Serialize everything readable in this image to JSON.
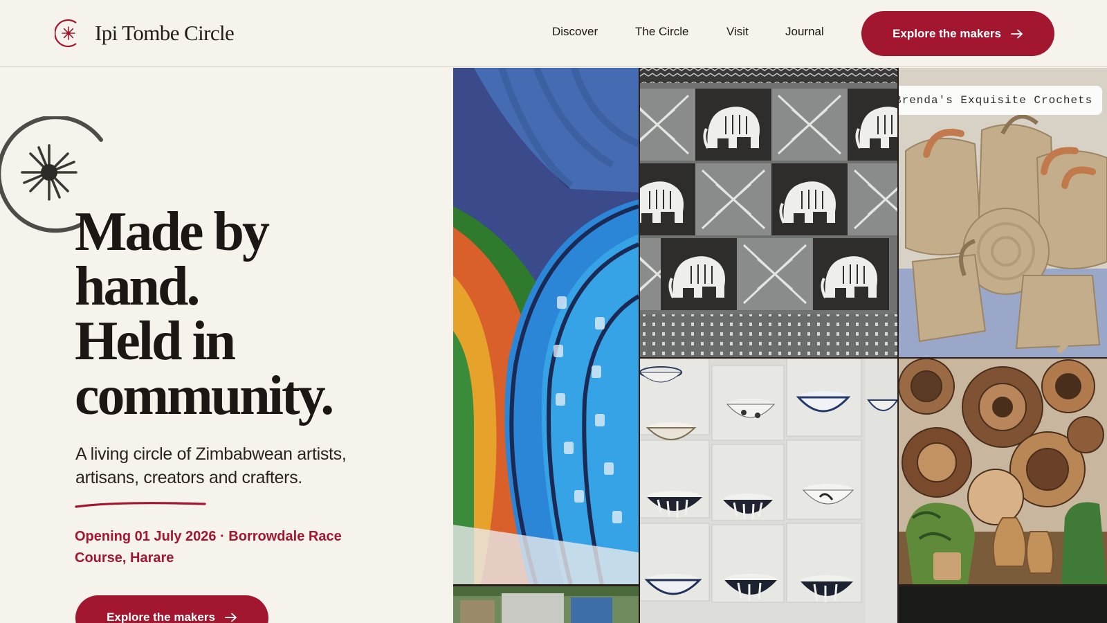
{
  "brand": {
    "name": "Ipi Tombe Circle",
    "logo_icon": "starburst-circle-icon",
    "accent": "#a3162f",
    "background": "#f6f2ec"
  },
  "nav": {
    "items": [
      {
        "label": "Discover"
      },
      {
        "label": "The Circle"
      },
      {
        "label": "Visit"
      },
      {
        "label": "Journal"
      }
    ],
    "cta_label": "Explore the makers",
    "cta_icon": "arrow-right-icon"
  },
  "hero": {
    "headline": [
      "Made by",
      "hand.",
      "Held in",
      "community."
    ],
    "lede": "A living circle of Zimbabwean artists, artisans, creators and crafters.",
    "opening": "Opening 01 July 2026 · Borrowdale Race Course, Harare",
    "cta_label": "Explore the makers",
    "cta_icon": "arrow-right-icon",
    "emblem_icon": "starburst-circle-icon"
  },
  "gallery": {
    "tiles": [
      {
        "name": "printed-fabric-rolls-photo"
      },
      {
        "name": "market-stall-photo"
      },
      {
        "name": "elephant-print-textile-photo"
      },
      {
        "name": "ceramic-bowls-photo"
      },
      {
        "name": "crochet-bags-photo",
        "sign_text": "Brenda's Exquisite Crochets"
      },
      {
        "name": "woven-baskets-photo"
      }
    ]
  }
}
